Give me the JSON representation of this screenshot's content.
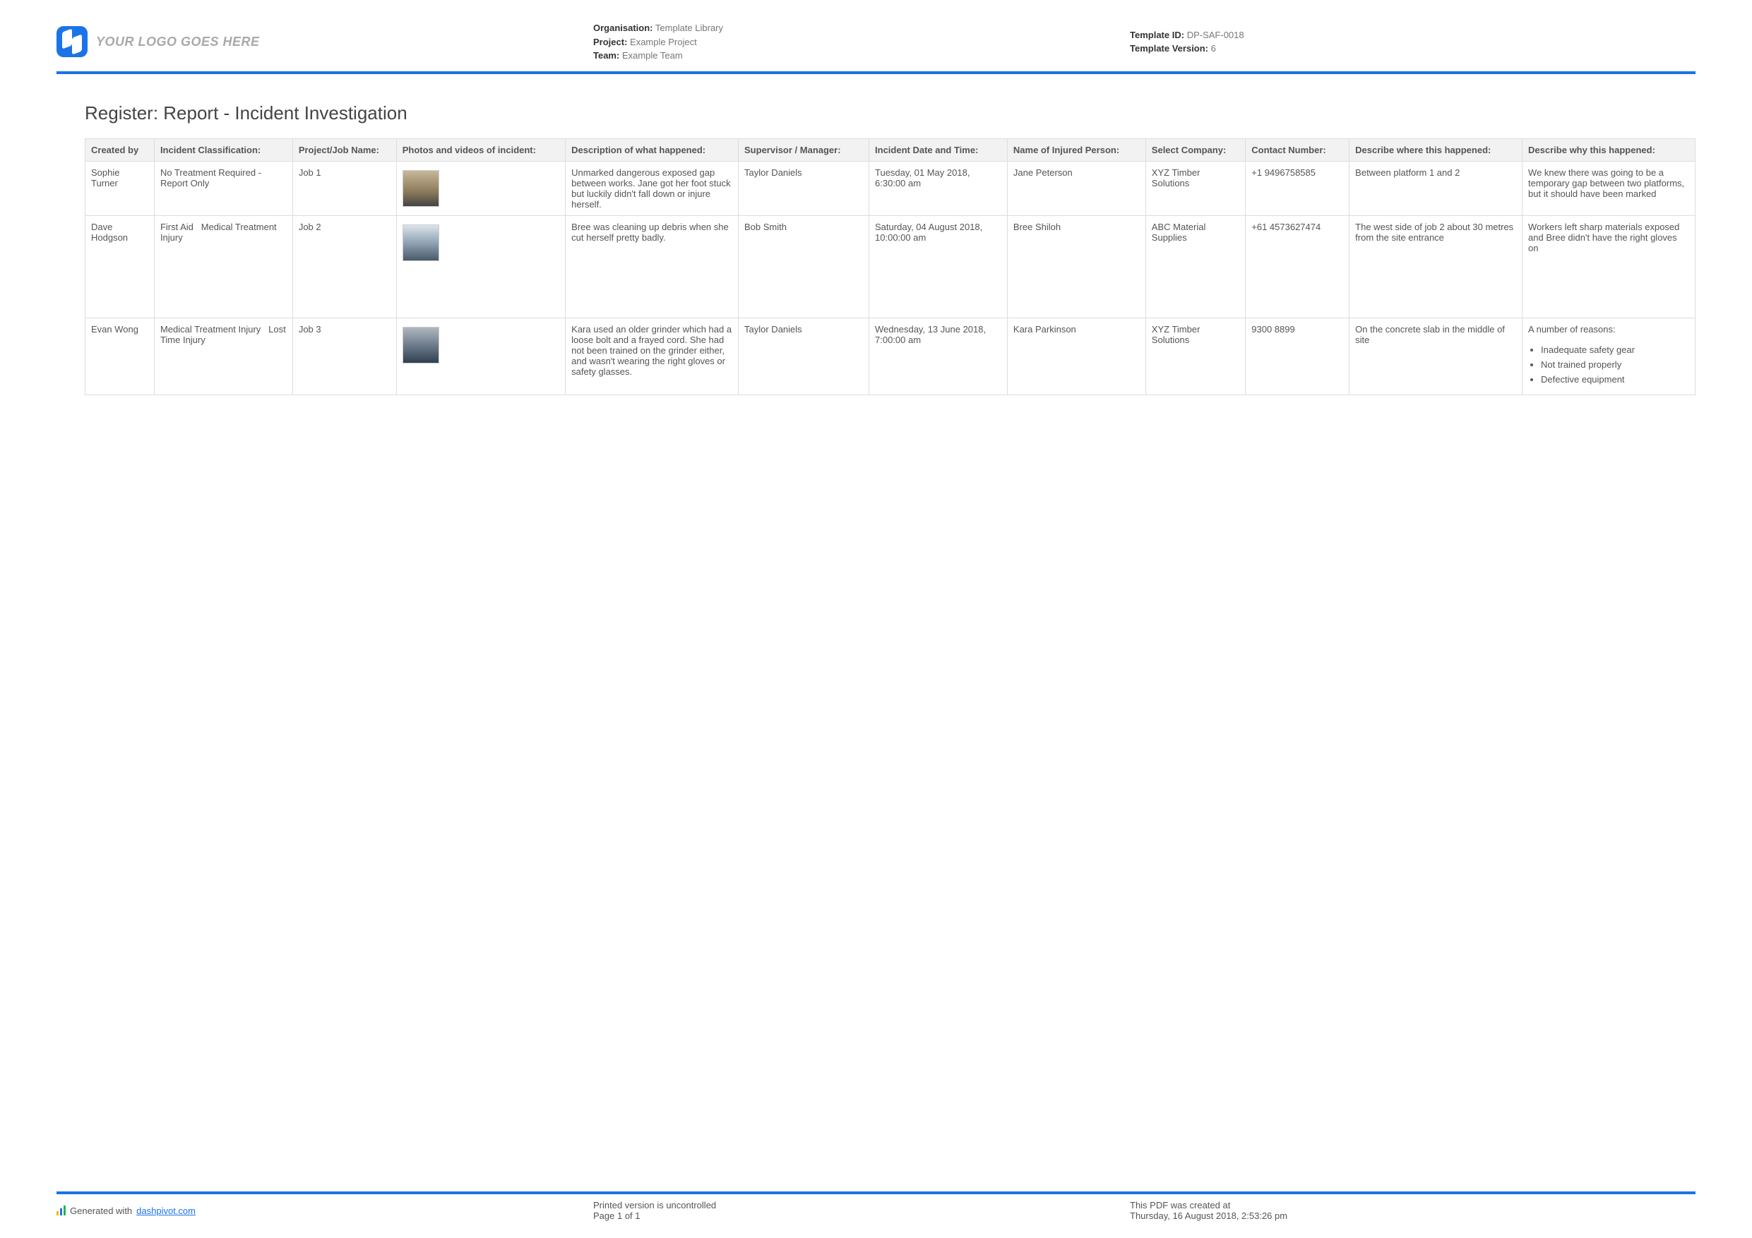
{
  "header": {
    "logo_text": "YOUR LOGO GOES HERE",
    "meta_center": {
      "org_label": "Organisation:",
      "org_value": "Template Library",
      "project_label": "Project:",
      "project_value": "Example Project",
      "team_label": "Team:",
      "team_value": "Example Team"
    },
    "meta_right": {
      "tid_label": "Template ID:",
      "tid_value": "DP-SAF-0018",
      "tver_label": "Template Version:",
      "tver_value": "6"
    }
  },
  "title": "Register: Report - Incident Investigation",
  "columns": {
    "created_by": "Created by",
    "classification": "Incident Classification:",
    "job": "Project/Job Name:",
    "photos": "Photos and videos of incident:",
    "description": "Description of what happened:",
    "supervisor": "Supervisor / Manager:",
    "datetime": "Incident Date and Time:",
    "injured": "Name of Injured Person:",
    "company": "Select Company:",
    "contact": "Contact Number:",
    "where": "Describe where this happened:",
    "why": "Describe why this happened:"
  },
  "rows": [
    {
      "created_by": "Sophie Turner",
      "classification": "No Treatment Required - Report Only",
      "job": "Job 1",
      "description": "Unmarked dangerous exposed gap between works. Jane got her foot stuck but luckily didn't fall down or injure herself.",
      "supervisor": "Taylor Daniels",
      "datetime": "Tuesday, 01 May 2018, 6:30:00 am",
      "injured": "Jane Peterson",
      "company": "XYZ Timber Solutions",
      "contact": "+1 9496758585",
      "where": "Between platform 1 and 2",
      "why_text": "We knew there was going to be a temporary gap between two platforms, but it should have been marked"
    },
    {
      "created_by": "Dave Hodgson",
      "classification": "First Aid   Medical Treatment Injury",
      "job": "Job 2",
      "description": "Bree was cleaning up debris when she cut herself pretty badly.",
      "supervisor": "Bob Smith",
      "datetime": "Saturday, 04 August 2018, 10:00:00 am",
      "injured": "Bree Shiloh",
      "company": "ABC Material Supplies",
      "contact": "+61 4573627474",
      "where": "The west side of job 2 about 30 metres from the site entrance",
      "why_text": "Workers left sharp materials exposed and Bree didn't have the right gloves on"
    },
    {
      "created_by": "Evan Wong",
      "classification": "Medical Treatment Injury   Lost Time Injury",
      "job": "Job 3",
      "description": "Kara used an older grinder which had a loose bolt and a frayed cord. She had not been trained on the grinder either, and wasn't wearing the right gloves or safety glasses.",
      "supervisor": "Taylor Daniels",
      "datetime": "Wednesday, 13 June 2018, 7:00:00 am",
      "injured": "Kara Parkinson",
      "company": "XYZ Timber Solutions",
      "contact": "9300 8899",
      "where": "On the concrete slab in the middle of site",
      "why_text": "A number of reasons:",
      "why_list": [
        "Inadequate safety gear",
        "Not trained properly",
        "Defective equipment"
      ]
    }
  ],
  "footer": {
    "gen_prefix": "Generated with ",
    "gen_link": "dashpivot.com",
    "mid_line1": "Printed version is uncontrolled",
    "mid_line2": "Page 1 of 1",
    "right_line1": "This PDF was created at",
    "right_line2": "Thursday, 16 August 2018, 2:53:26 pm"
  }
}
